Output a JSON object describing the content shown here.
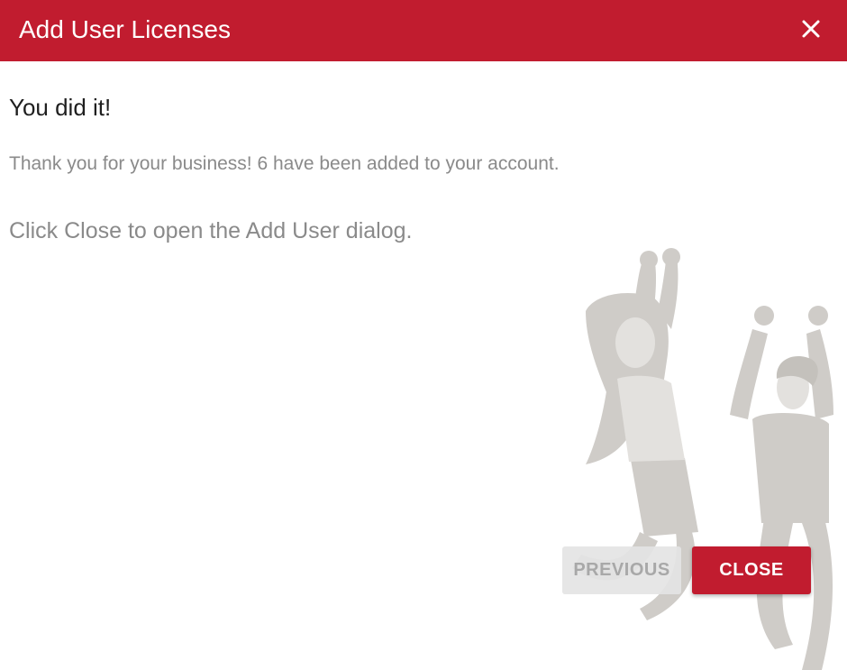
{
  "dialog": {
    "title": "Add User Licenses",
    "heading": "You did it!",
    "message": "Thank you for your business! 6 have been added to your account.",
    "instruction": "Click Close to open the Add User dialog.",
    "buttons": {
      "previous_label": "PREVIOUS",
      "close_label": "CLOSE"
    },
    "close_icon": "close-icon",
    "illustration": "celebrating-people-illustration"
  },
  "colors": {
    "brand_red": "#c11c2f",
    "heading_text": "#1f1f1f",
    "body_text": "#8a8a8a",
    "illustration_fill": "#cfccc8"
  }
}
